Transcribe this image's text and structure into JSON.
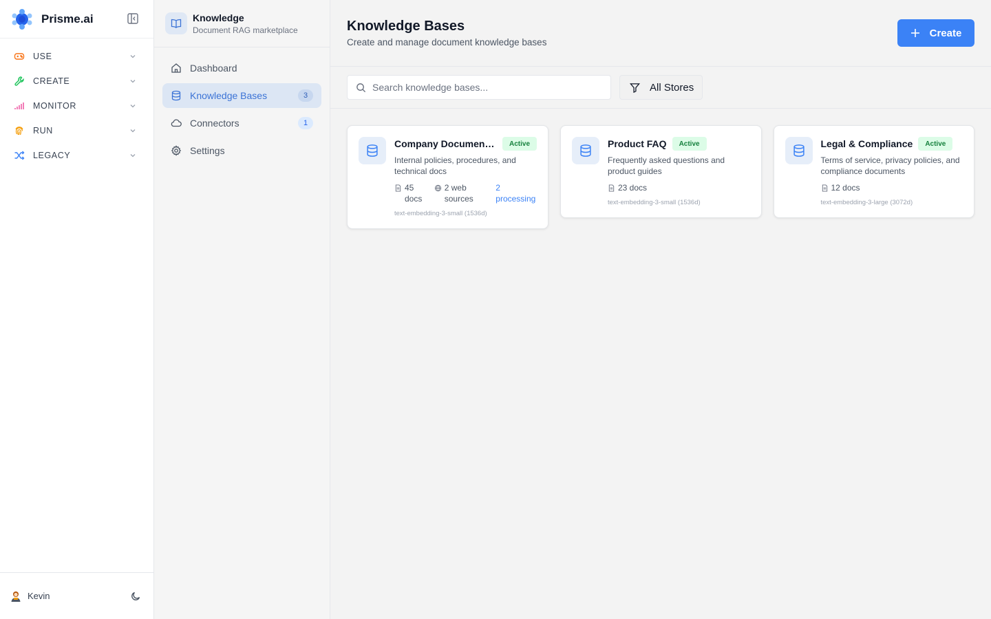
{
  "app": {
    "brand": "Prisme.ai"
  },
  "nav_groups": [
    {
      "label": "USE",
      "icon": "gamepad-icon",
      "color": "#f97316"
    },
    {
      "label": "CREATE",
      "icon": "wrench-icon",
      "color": "#22c55e"
    },
    {
      "label": "MONITOR",
      "icon": "signal-bars-icon",
      "color": "#ec4899"
    },
    {
      "label": "RUN",
      "icon": "fingerprint-icon",
      "color": "#f59e0b"
    },
    {
      "label": "LEGACY",
      "icon": "shuffle-icon",
      "color": "#3b82f6"
    }
  ],
  "user": {
    "name": "Kevin"
  },
  "module": {
    "title": "Knowledge",
    "subtitle": "Document RAG marketplace",
    "nav": [
      {
        "label": "Dashboard",
        "icon": "home-icon",
        "badge": ""
      },
      {
        "label": "Knowledge Bases",
        "icon": "database-icon",
        "badge": "3",
        "active": true
      },
      {
        "label": "Connectors",
        "icon": "cloud-icon",
        "badge": "1"
      },
      {
        "label": "Settings",
        "icon": "gear-icon",
        "badge": ""
      }
    ]
  },
  "page": {
    "title": "Knowledge Bases",
    "subtitle": "Create and manage document knowledge bases",
    "create_label": "Create",
    "search_placeholder": "Search knowledge bases...",
    "filter_label": "All Stores"
  },
  "cards": [
    {
      "title": "Company Documenta...",
      "status": "Active",
      "description": "Internal policies, procedures, and technical docs",
      "docs": "45 docs",
      "web_sources": "2 web sources",
      "processing": "2 processing",
      "model": "text-embedding-3-small (1536d)"
    },
    {
      "title": "Product FAQ",
      "status": "Active",
      "description": "Frequently asked questions and product guides",
      "docs": "23 docs",
      "model": "text-embedding-3-small (1536d)"
    },
    {
      "title": "Legal & Compliance",
      "status": "Active",
      "description": "Terms of service, privacy policies, and compliance documents",
      "docs": "12 docs",
      "model": "text-embedding-3-large (3072d)"
    }
  ],
  "colors": {
    "accent": "#3b82f6",
    "active_bg": "#dce6f4",
    "status_bg": "#dcfce7",
    "status_text": "#15803d"
  }
}
